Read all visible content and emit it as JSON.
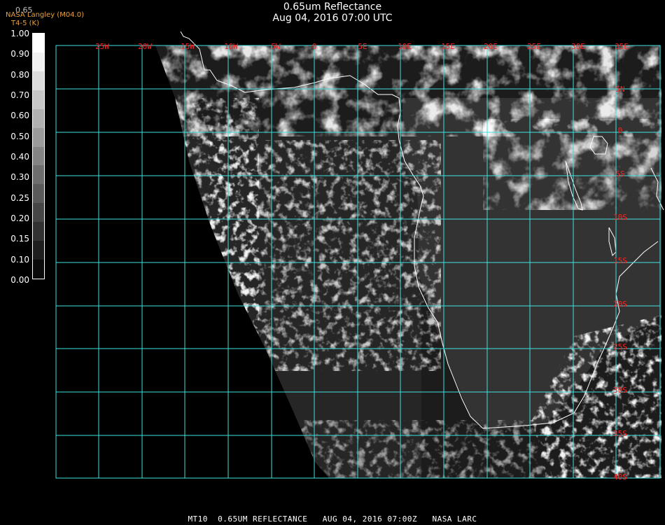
{
  "title": {
    "line1": "0.65um Reflectance",
    "line2": "Aug 04, 2016 07:00 UTC"
  },
  "credit": {
    "band": "0.65",
    "org": "NASA Langley (M04.0)",
    "temp": "T4-5 (K)"
  },
  "colorbar": {
    "labels": [
      "1.00",
      "0.90",
      "0.80",
      "0.70",
      "0.60",
      "0.50",
      "0.40",
      "0.30",
      "0.25",
      "0.20",
      "0.15",
      "0.10",
      "0.00"
    ],
    "colors": [
      "#ffffff",
      "#f0f0f0",
      "#dcdcdc",
      "#c6c6c6",
      "#b0b0b0",
      "#9a9a9a",
      "#848484",
      "#6e6e6e",
      "#5a5a5a",
      "#464646",
      "#323232",
      "#1e1e1e",
      "#0a0a0a"
    ]
  },
  "map": {
    "grid_color": "#40e0e0",
    "label_color": "#ff2020",
    "coast_color": "#ffffff",
    "lon_labels": [
      "25W",
      "20W",
      "15W",
      "10W",
      "5W",
      "0",
      "5E",
      "10E",
      "15E",
      "20E",
      "25E",
      "30E",
      "35E"
    ],
    "lat_labels": [
      "5N",
      "0",
      "5S",
      "10S",
      "15S",
      "20S",
      "25S",
      "30S",
      "35S",
      "40S"
    ]
  },
  "footer": "MT10  0.65UM REFLECTANCE   AUG 04, 2016 07:00Z   NASA LARC"
}
